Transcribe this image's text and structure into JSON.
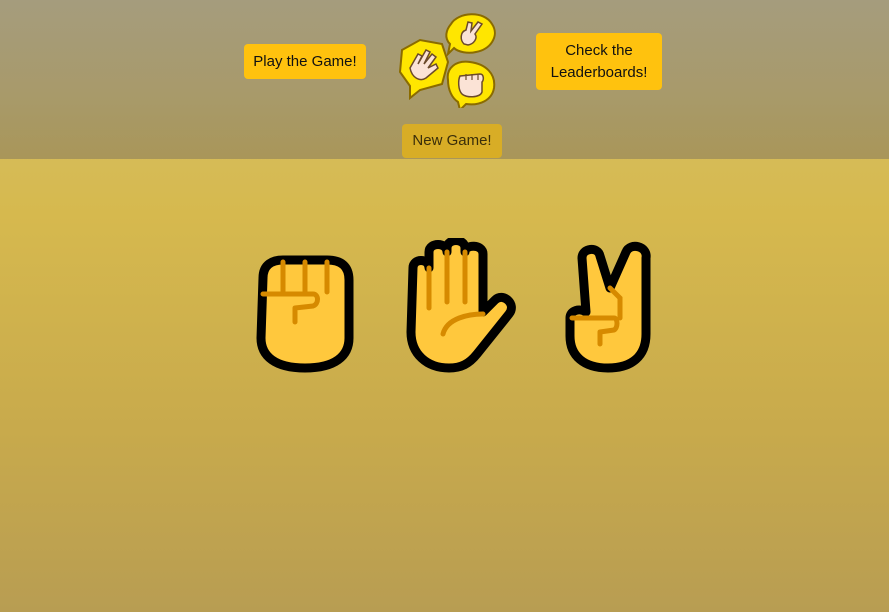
{
  "nav": {
    "play_label": "Play the Game!",
    "leaderboard_label_line1": "Check the",
    "leaderboard_label_line2": "Leaderboards!",
    "new_game_label": "New Game!"
  },
  "logo": {
    "icon": "rock-paper-scissors-logo-icon"
  },
  "choices": [
    {
      "name": "rock",
      "icon": "raised-fist-icon"
    },
    {
      "name": "paper",
      "icon": "raised-hand-icon"
    },
    {
      "name": "scissors",
      "icon": "victory-hand-icon"
    }
  ],
  "colors": {
    "button": "#ffc20e",
    "new_game_button": "#d8ad26",
    "hand_fill": "#ffc83d",
    "hand_outline": "#000000",
    "hand_detail": "#d67d00"
  }
}
